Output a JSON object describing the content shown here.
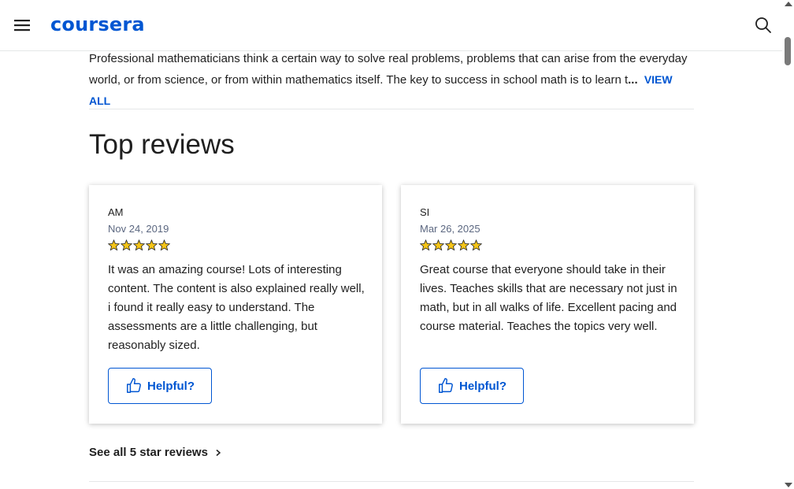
{
  "header": {
    "logo": "coursera",
    "brand_color": "#0056d2"
  },
  "description": {
    "text": "Professional mathematicians think a certain way to solve real problems, problems that can arise from the everyday world, or from science, or from within mathematics itself. The key to success in school math is to learn t",
    "ellipsis": "...",
    "view_all": "VIEW ALL"
  },
  "reviews_section": {
    "title": "Top reviews",
    "reviews": [
      {
        "reviewer": "AM",
        "date": "Nov 24, 2019",
        "rating": 5,
        "text": "It was an amazing course! Lots of interesting content. The content is also explained really well, i found it really easy to understand. The assessments are a little challenging, but reasonably sized.",
        "helpful_label": "Helpful?"
      },
      {
        "reviewer": "SI",
        "date": "Mar 26, 2025",
        "rating": 5,
        "text": "Great course that everyone should take in their lives. Teaches skills that are necessary not just in math, but in all walks of life. Excellent pacing and course material. Teaches the topics very well.",
        "helpful_label": "Helpful?"
      }
    ],
    "see_all": "See all 5 star reviews"
  },
  "icons": {
    "menu": "menu-icon",
    "search": "search-icon",
    "star": "star-icon",
    "thumbs_up": "thumbs-up-icon",
    "chevron": "chevron-right-icon"
  },
  "colors": {
    "star": "#f5c518",
    "muted_text": "#5b6780"
  }
}
